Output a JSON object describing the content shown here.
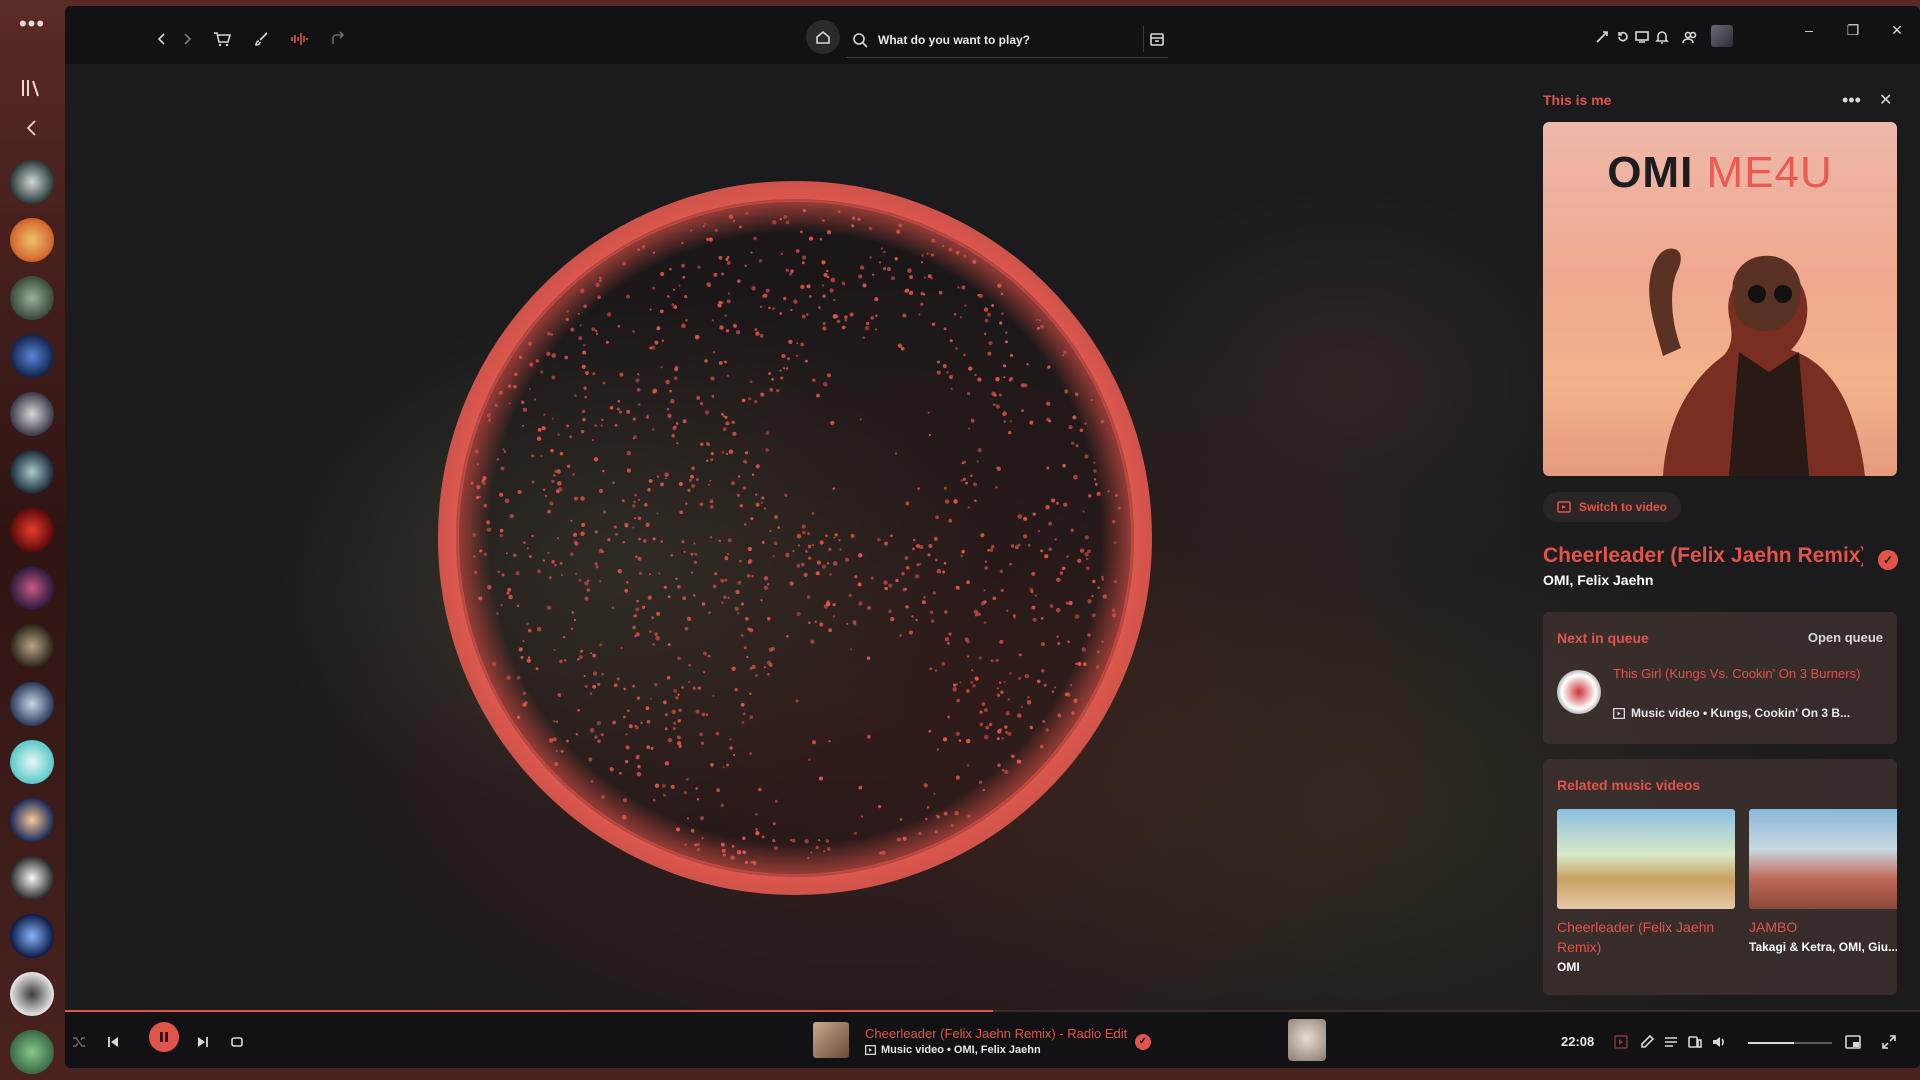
{
  "search": {
    "placeholder": "What do you want to play?"
  },
  "panel": {
    "title": "This is me",
    "cover": {
      "artist_text": "OMI",
      "album_text": "ME4U"
    },
    "switch_label": "Switch to video",
    "track_title": "Cheerleader (Felix Jaehn Remix)",
    "track_artists": "OMI, Felix Jaehn",
    "queue": {
      "heading": "Next in queue",
      "open_label": "Open queue",
      "song": "This Girl (Kungs Vs. Cookin' On 3 Burners)",
      "meta": "Music video • Kungs, Cookin' On 3 B..."
    },
    "related": {
      "heading": "Related music videos",
      "items": [
        {
          "title": "Cheerleader (Felix Jaehn Remix)",
          "artist": "OMI"
        },
        {
          "title": "JAMBO",
          "artist": "Takagi & Ketra, OMI, Giu..."
        }
      ]
    }
  },
  "player": {
    "title": "Cheerleader (Felix Jaehn Remix) - Radio Edit",
    "meta": "Music video • OMI, Felix Jaehn",
    "time": "22:08",
    "progress": 0.5,
    "volume": 0.55
  },
  "colors": {
    "accent": "#e0544b",
    "bg": "#121214"
  },
  "icons": {
    "top": [
      "menu-dots-icon",
      "library-icon",
      "collapse-icon",
      "back-icon",
      "forward-icon",
      "cart-icon",
      "brush-icon",
      "waveform-icon",
      "share-icon",
      "home-icon",
      "search-icon",
      "browse-icon",
      "bell-icon",
      "friends-icon"
    ],
    "player": [
      "shuffle-icon",
      "previous-icon",
      "pause-icon",
      "next-icon",
      "repeat-icon",
      "lyrics-icon",
      "queue-icon",
      "devices-icon",
      "volume-icon",
      "miniplayer-icon",
      "fullscreen-icon"
    ]
  }
}
